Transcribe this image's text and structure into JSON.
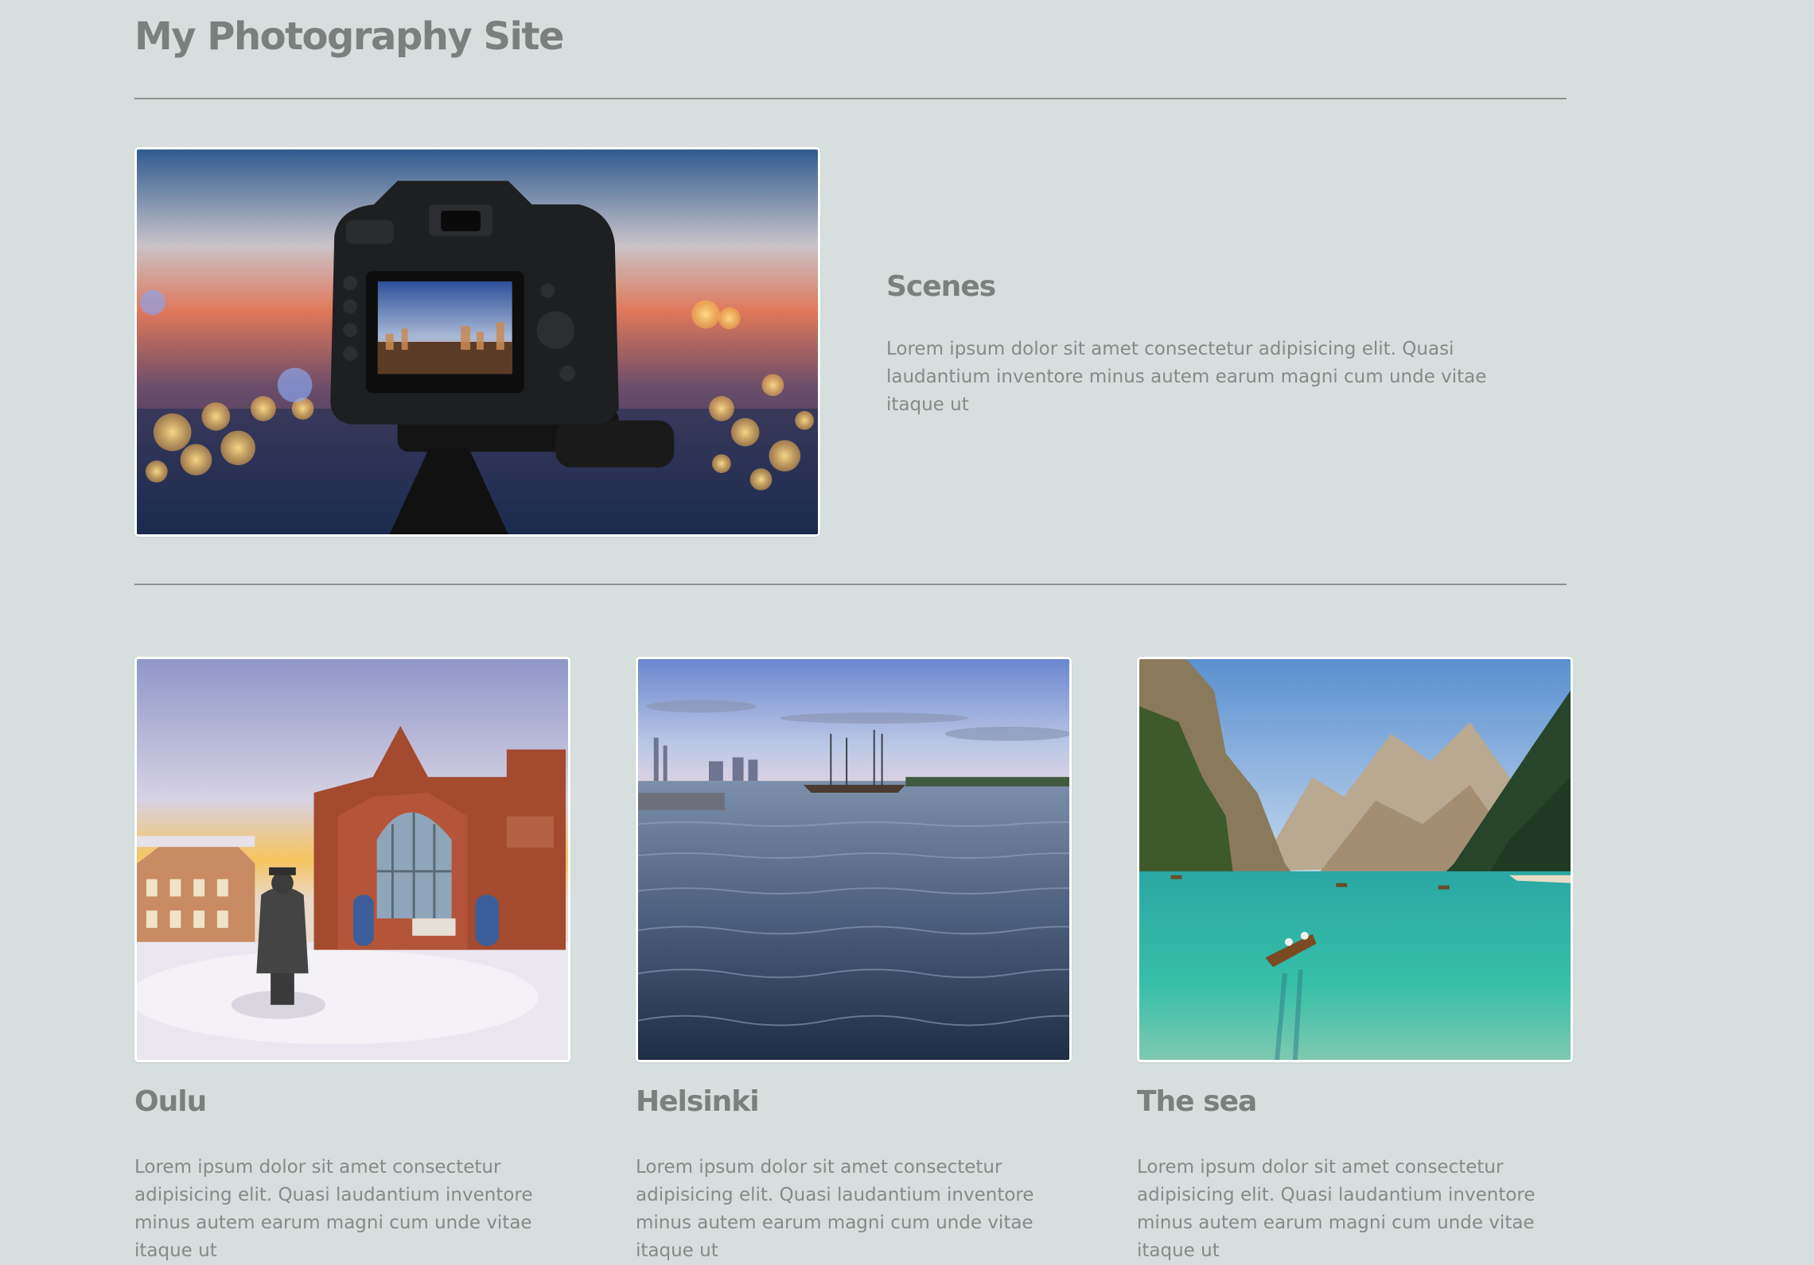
{
  "site": {
    "title": "My Photography Site"
  },
  "feature": {
    "title": "Scenes",
    "text": "Lorem ipsum dolor sit amet consectetur adipisicing elit. Quasi laudantium inventore minus autem earum magni cum unde vitae itaque ut",
    "image": "camera-on-tripod-photo"
  },
  "gallery": [
    {
      "title": "Oulu",
      "text": "Lorem ipsum dolor sit amet consectetur adipisicing elit. Quasi laudantium inventore minus autem earum magni cum unde vitae itaque ut",
      "image": "oulu-market-hall-photo"
    },
    {
      "title": "Helsinki",
      "text": "Lorem ipsum dolor sit amet consectetur adipisicing elit. Quasi laudantium inventore minus autem earum magni cum unde vitae itaque ut",
      "image": "helsinki-harbor-photo"
    },
    {
      "title": "The sea",
      "text": "Lorem ipsum dolor sit amet consectetur adipisicing elit. Quasi laudantium inventore minus autem earum magni cum unde vitae itaque ut",
      "image": "mountain-lake-photo"
    }
  ],
  "colors": {
    "background": "#d6dfde",
    "text": "#7b7f7d",
    "frame": "#ffffff"
  }
}
